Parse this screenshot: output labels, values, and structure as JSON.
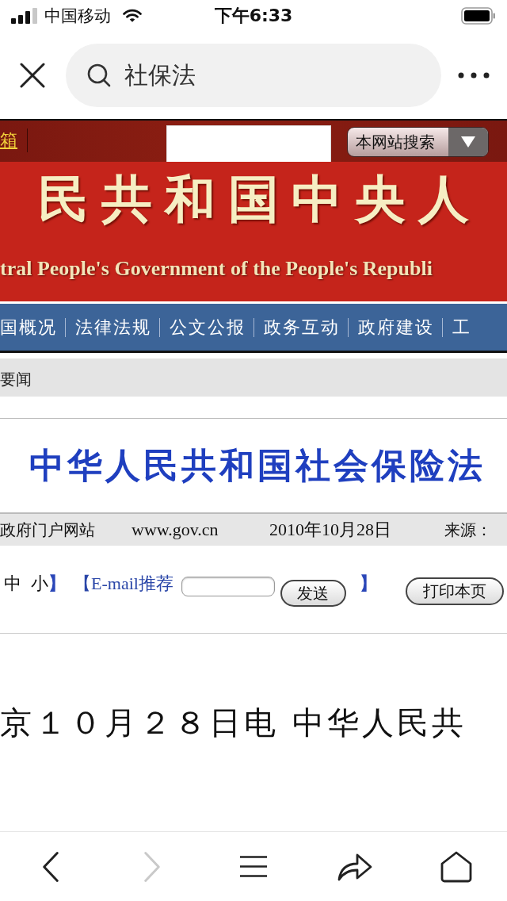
{
  "status_bar": {
    "carrier": "中国移动",
    "time": "下午6:33"
  },
  "browser_bar": {
    "search": {
      "value": "社保法"
    }
  },
  "site_header": {
    "link": "箱",
    "site_search": {
      "label": "本网站搜索"
    }
  },
  "banner": {
    "title_cn": "民共和国中央人",
    "title_en": "tral People's Government of the People's Republi"
  },
  "nav": {
    "items": [
      "国概况",
      "法律法规",
      "公文公报",
      "政务互动",
      "政府建设",
      "工"
    ]
  },
  "section_bar": {
    "label": "要闻"
  },
  "article": {
    "title": "中华人民共和国社会保险法",
    "meta": {
      "site": "政府门户网站",
      "url": "www.gov.cn",
      "date": "2010年10月28日",
      "source_label": "来源："
    },
    "tools": {
      "font_sizes": [
        "中",
        "小"
      ],
      "size_close": "】",
      "email_label": "【E-mail推荐",
      "send_button": "发送",
      "email_close": "】",
      "print_button": "打印本页"
    },
    "body": "京１０月２８日电 中华人民共"
  },
  "bottom_toolbar": {
    "buttons": [
      {
        "kind": "back",
        "disabled": false
      },
      {
        "kind": "forward",
        "disabled": true
      },
      {
        "kind": "menu",
        "disabled": false
      },
      {
        "kind": "share",
        "disabled": false
      },
      {
        "kind": "home",
        "disabled": false
      }
    ]
  }
}
